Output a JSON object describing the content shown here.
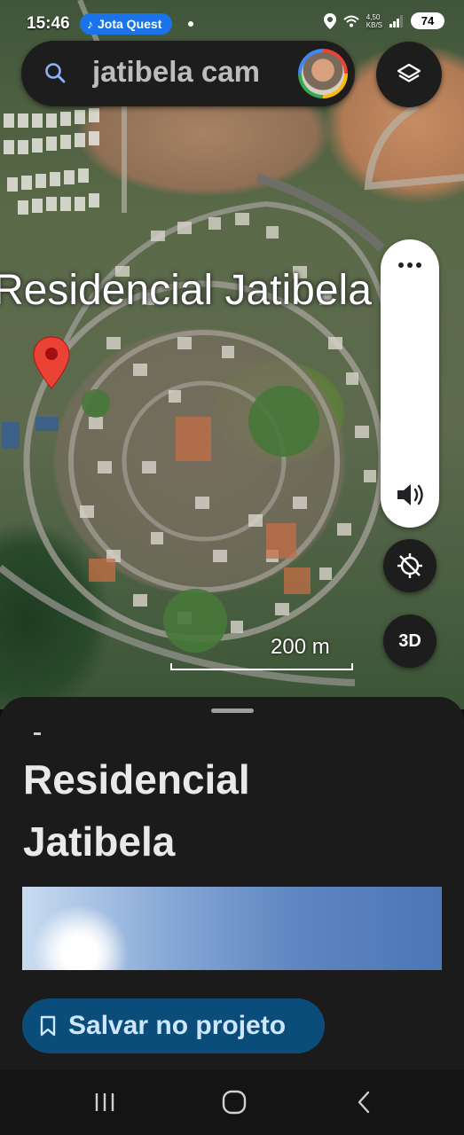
{
  "status_bar": {
    "time": "15:46",
    "media_label": "Jota Quest",
    "net_speed_top": "4,50",
    "net_speed_bottom": "KB/S",
    "battery": "74"
  },
  "search": {
    "query": "jatibela cam"
  },
  "map": {
    "place_label": "Residencial Jatibela",
    "scale": "200 m",
    "btn_3d": "3D"
  },
  "sheet": {
    "title": "Residencial Jatibela",
    "save_button": "Salvar no projeto"
  },
  "icons": {
    "search": "search-icon",
    "layers": "layers-icon",
    "more": "more-horizontal-icon",
    "sound": "volume-icon",
    "compass": "compass-off-icon",
    "pin": "location-pin-icon",
    "bookmark": "bookmark-icon"
  },
  "colors": {
    "accent": "#1a73e8",
    "save_button_bg": "#0b4d7a",
    "pin": "#ea4335",
    "sheet_bg": "#1b1b1b"
  }
}
